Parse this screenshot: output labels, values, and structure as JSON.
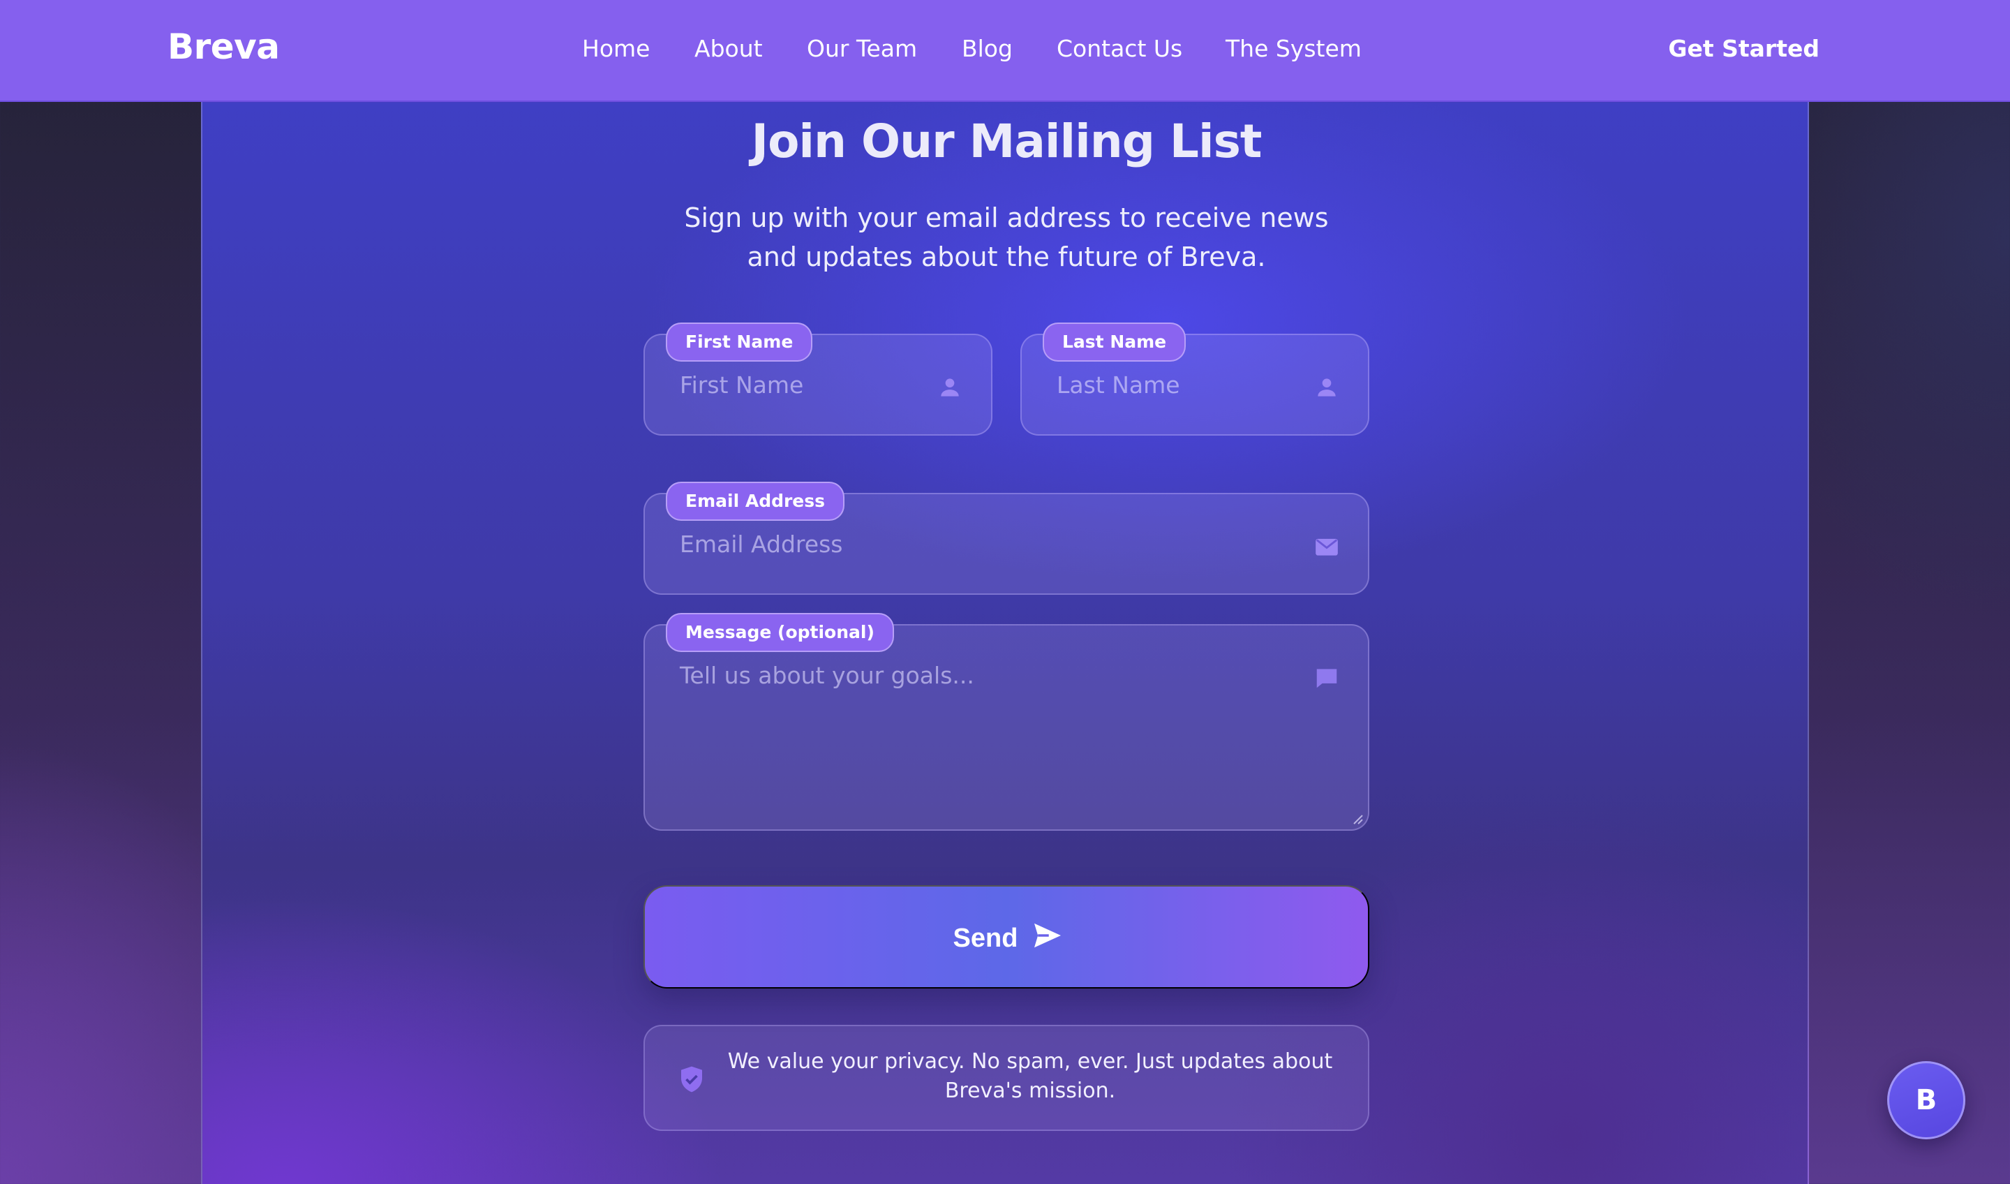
{
  "nav": {
    "brand": "Breva",
    "links": [
      "Home",
      "About",
      "Our Team",
      "Blog",
      "Contact Us",
      "The System"
    ],
    "cta": "Get Started"
  },
  "hero": {
    "title": "Join Our Mailing List",
    "subtitle": "Sign up with your email address to receive news and updates about the future of Breva."
  },
  "form": {
    "first_name": {
      "label": "First Name",
      "placeholder": "First Name",
      "icon": "user-icon"
    },
    "last_name": {
      "label": "Last Name",
      "placeholder": "Last Name",
      "icon": "user-icon"
    },
    "email": {
      "label": "Email Address",
      "placeholder": "Email Address",
      "icon": "mail-icon"
    },
    "message": {
      "label": "Message (optional)",
      "placeholder": "Tell us about your goals...",
      "icon": "chat-icon"
    },
    "submit_label": "Send",
    "submit_icon": "send-icon"
  },
  "privacy": {
    "text": "We value your privacy. No spam, ever. Just updates about Breva's mission.",
    "icon": "shield-check-icon"
  },
  "fab": {
    "label": "B"
  },
  "colors": {
    "nav_bg": "#8560ee",
    "accent": "#8a64f0",
    "button_start": "#7a5cf0",
    "button_end": "#8f5aee"
  }
}
